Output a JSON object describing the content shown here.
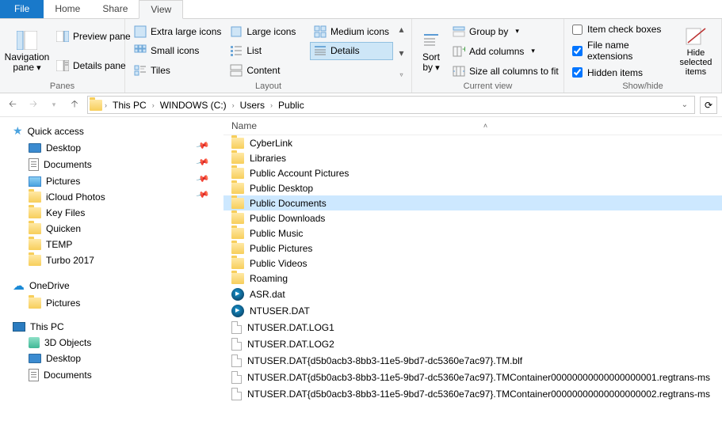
{
  "tabs": {
    "file": "File",
    "home": "Home",
    "share": "Share",
    "view": "View"
  },
  "ribbon": {
    "panes": {
      "nav": "Navigation pane",
      "preview": "Preview pane",
      "details": "Details pane",
      "label": "Panes"
    },
    "layout": {
      "xl": "Extra large icons",
      "lg": "Large icons",
      "md": "Medium icons",
      "sm": "Small icons",
      "list": "List",
      "details": "Details",
      "tiles": "Tiles",
      "content": "Content",
      "label": "Layout"
    },
    "sort": {
      "btn": "Sort by",
      "label": "Current view",
      "group": "Group by",
      "addcols": "Add columns",
      "sizecols": "Size all columns to fit"
    },
    "showhide": {
      "chk1": "Item check boxes",
      "chk2": "File name extensions",
      "chk3": "Hidden items",
      "hide": "Hide selected items",
      "label": "Show/hide"
    }
  },
  "breadcrumbs": [
    "This PC",
    "WINDOWS (C:)",
    "Users",
    "Public"
  ],
  "nav": {
    "quick": "Quick access",
    "quick_items": [
      "Desktop",
      "Documents",
      "Pictures",
      "iCloud Photos",
      "Key Files",
      "Quicken",
      "TEMP",
      "Turbo 2017"
    ],
    "onedrive": "OneDrive",
    "onedrive_items": [
      "Pictures"
    ],
    "thispc": "This PC",
    "thispc_items": [
      "3D Objects",
      "Desktop",
      "Documents"
    ]
  },
  "list": {
    "header": "Name",
    "items": [
      {
        "t": "folder",
        "n": "CyberLink"
      },
      {
        "t": "folder",
        "n": "Libraries"
      },
      {
        "t": "folder",
        "n": "Public Account Pictures"
      },
      {
        "t": "folder",
        "n": "Public Desktop"
      },
      {
        "t": "folder",
        "n": "Public Documents",
        "sel": true
      },
      {
        "t": "folder",
        "n": "Public Downloads"
      },
      {
        "t": "folder",
        "n": "Public Music"
      },
      {
        "t": "folder",
        "n": "Public Pictures"
      },
      {
        "t": "folder",
        "n": "Public Videos"
      },
      {
        "t": "folder",
        "n": "Roaming"
      },
      {
        "t": "dat",
        "n": "ASR.dat"
      },
      {
        "t": "dat",
        "n": "NTUSER.DAT"
      },
      {
        "t": "file",
        "n": "NTUSER.DAT.LOG1"
      },
      {
        "t": "file",
        "n": "NTUSER.DAT.LOG2"
      },
      {
        "t": "file",
        "n": "NTUSER.DAT{d5b0acb3-8bb3-11e5-9bd7-dc5360e7ac97}.TM.blf"
      },
      {
        "t": "file",
        "n": "NTUSER.DAT{d5b0acb3-8bb3-11e5-9bd7-dc5360e7ac97}.TMContainer00000000000000000001.regtrans-ms"
      },
      {
        "t": "file",
        "n": "NTUSER.DAT{d5b0acb3-8bb3-11e5-9bd7-dc5360e7ac97}.TMContainer00000000000000000002.regtrans-ms"
      }
    ]
  }
}
